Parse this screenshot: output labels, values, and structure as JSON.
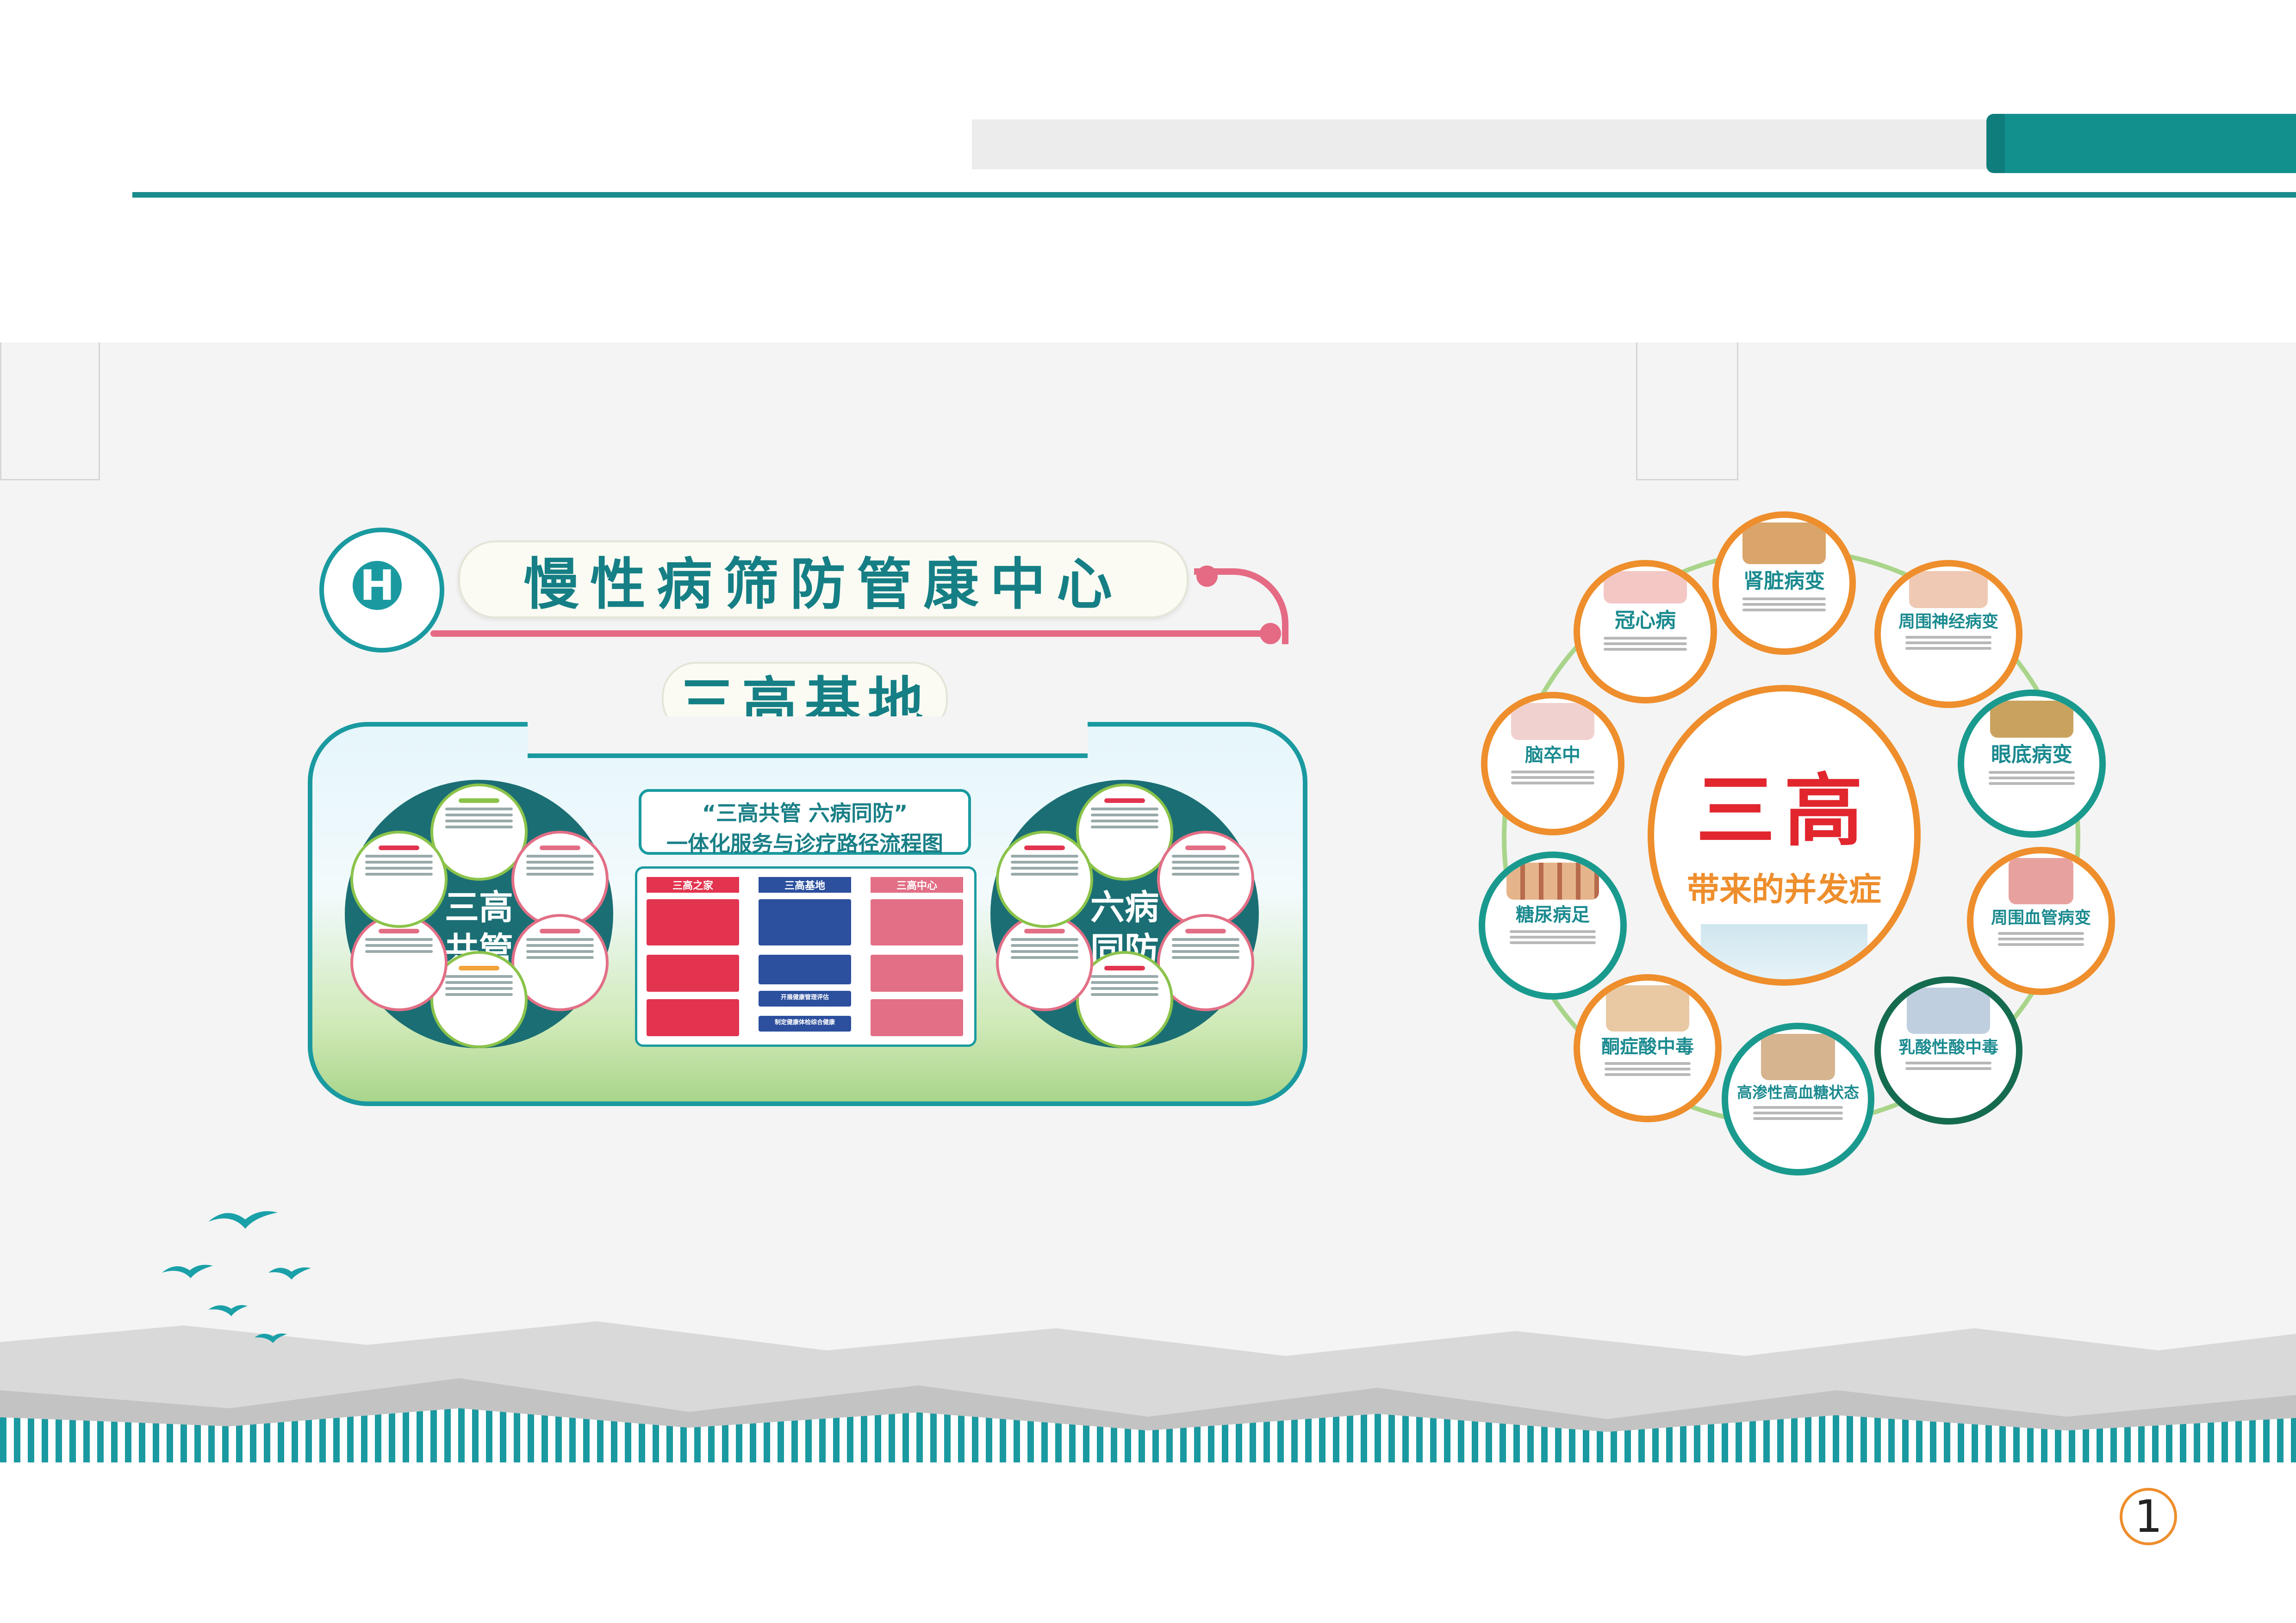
{
  "header": {
    "center_name": "慢性病筛防管康中心",
    "base_name": "三高基地"
  },
  "left_board": {
    "disc_left_label": "三高\n共管",
    "disc_right_label": "六病\n同防",
    "flow_title_line1": "“三高共管 六病同防”",
    "flow_title_line2": "一体化服务与诊疗路径流程图",
    "flow_columns": [
      "三高之家",
      "三高基地",
      "三高中心"
    ],
    "flow_mid_boxes": [
      "开展健康管理评估",
      "制定健康体检综合健康"
    ],
    "colors": {
      "red": "#e2344f",
      "blue": "#2c4f9e",
      "pink": "#e26f86",
      "teal": "#1a9aa0"
    }
  },
  "complications": {
    "center_title": "三高",
    "center_subtitle": "带来的并发症",
    "items": [
      {
        "name": "冠心病",
        "ring": "orange"
      },
      {
        "name": "肾脏病变",
        "ring": "orange"
      },
      {
        "name": "周围神经病变",
        "ring": "orange"
      },
      {
        "name": "眼底病变",
        "ring": "green"
      },
      {
        "name": "周围血管病变",
        "ring": "orange"
      },
      {
        "name": "乳酸性酸中毒",
        "ring": "darkgreen"
      },
      {
        "name": "高渗性高血糖状态",
        "ring": "green"
      },
      {
        "name": "酮症酸中毒",
        "ring": "orange"
      },
      {
        "name": "糖尿病足",
        "ring": "green"
      },
      {
        "name": "脑卒中",
        "ring": "orange"
      }
    ]
  },
  "page_number": "1"
}
